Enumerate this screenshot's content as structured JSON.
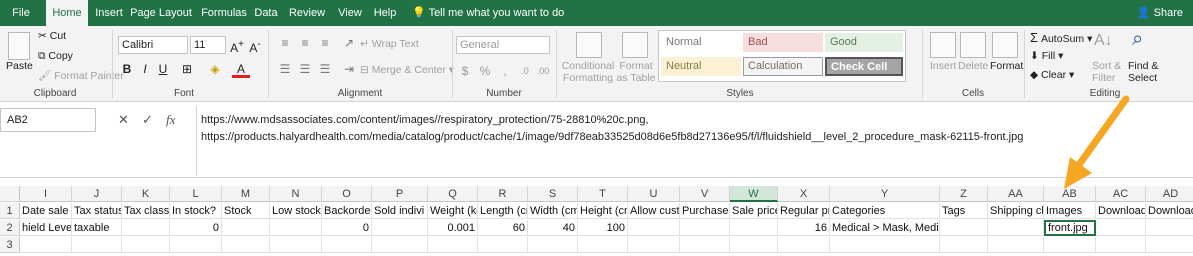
{
  "tabs": [
    "File",
    "Home",
    "Insert",
    "Page Layout",
    "Formulas",
    "Data",
    "Review",
    "View",
    "Help"
  ],
  "tell_me": "Tell me what you want to do",
  "share": "Share",
  "clipboard": {
    "paste": "Paste",
    "cut": "Cut",
    "copy": "Copy",
    "format_painter": "Format Painter",
    "label": "Clipboard"
  },
  "font": {
    "name": "Calibri",
    "size": "11",
    "label": "Font"
  },
  "alignment": {
    "wrap_text": "Wrap Text",
    "merge_center": "Merge & Center",
    "label": "Alignment"
  },
  "number": {
    "format": "General",
    "label": "Number"
  },
  "styles": {
    "conditional_formatting": "Conditional Formatting",
    "format_as_table": "Format as Table",
    "normal": "Normal",
    "bad": "Bad",
    "good": "Good",
    "neutral": "Neutral",
    "calculation": "Calculation",
    "check_cell": "Check Cell",
    "label": "Styles"
  },
  "cells": {
    "insert": "Insert",
    "delete": "Delete",
    "format": "Format",
    "label": "Cells"
  },
  "editing": {
    "autosum": "AutoSum",
    "fill": "Fill",
    "clear": "Clear",
    "sort_filter": "Sort & Filter",
    "find_select": "Find & Select",
    "label": "Editing"
  },
  "formula_bar": {
    "name_box": "AB2",
    "line1": "https://www.mdsassociates.com/content/images//respiratory_protection/75-28810%20c.png,",
    "line2": "https://products.halyardhealth.com/media/catalog/product/cache/1/image/9df78eab33525d08d6e5fb8d27136e95/f/l/fluidshield__level_2_procedure_mask-62115-front.jpg"
  },
  "columns": [
    "I",
    "J",
    "K",
    "L",
    "M",
    "N",
    "O",
    "P",
    "Q",
    "R",
    "S",
    "T",
    "U",
    "V",
    "W",
    "X",
    "Y",
    "Z",
    "AA",
    "AB",
    "AC",
    "AD"
  ],
  "rows": [
    "1",
    "2",
    "3"
  ],
  "header_row": [
    "Date sale p",
    "Tax status",
    "Tax class",
    "In stock?",
    "Stock",
    "Low stock",
    "Backorder",
    "Sold indivi",
    "Weight (kg",
    "Length (cm",
    "Width (cm",
    "Height (cm",
    "Allow cust",
    "Purchase n",
    "Sale price",
    "Regular pr",
    "Categories",
    "Tags",
    "Shipping cl",
    "Images",
    "Download",
    "Download"
  ],
  "data_row": [
    "hield Level",
    "taxable",
    "",
    "0",
    "",
    "",
    "0",
    "",
    "0.001",
    "60",
    "40",
    "100",
    "",
    "",
    "",
    "16",
    "Medical > Mask, Medical",
    "",
    "",
    "front.jpg",
    "",
    ""
  ],
  "colors": {
    "excel_green": "#217346",
    "arrow_orange": "#f5a623"
  }
}
